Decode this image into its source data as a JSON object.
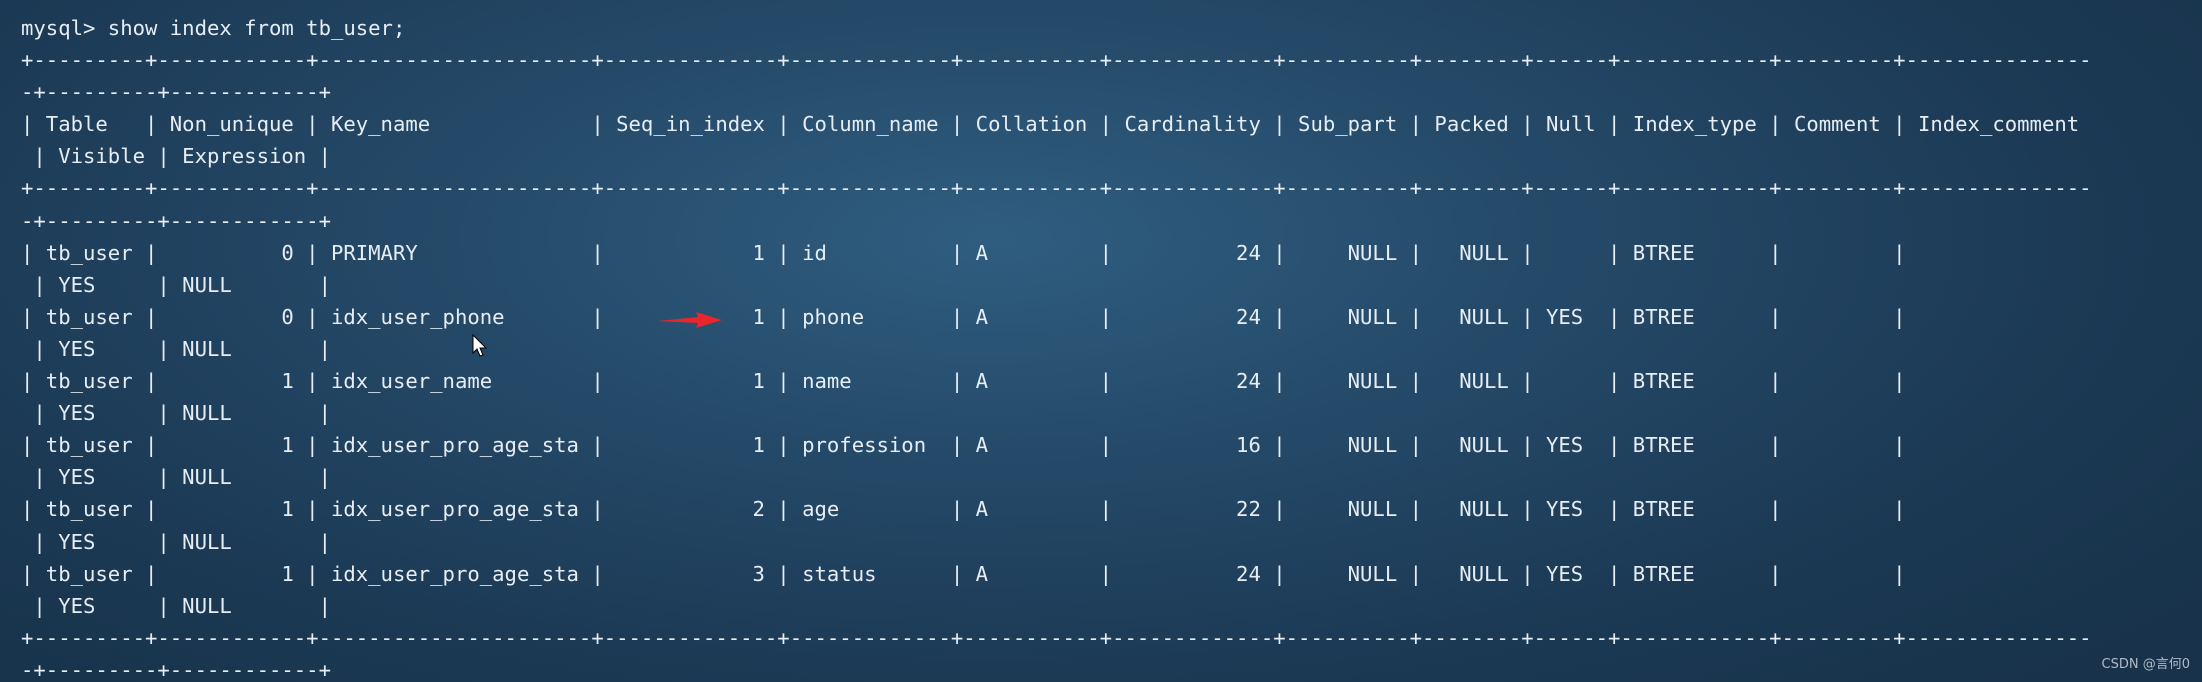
{
  "terminal": {
    "lines": [
      "mysql> show index from tb_user;",
      "+---------+------------+----------------------+--------------+-------------+-----------+-------------+----------+--------+------+------------+---------+---------------",
      "-+---------+------------+",
      "| Table   | Non_unique | Key_name             | Seq_in_index | Column_name | Collation | Cardinality | Sub_part | Packed | Null | Index_type | Comment | Index_comment",
      " | Visible | Expression |",
      "+---------+------------+----------------------+--------------+-------------+-----------+-------------+----------+--------+------+------------+---------+---------------",
      "-+---------+------------+",
      "| tb_user |          0 | PRIMARY              |            1 | id          | A         |          24 |     NULL |   NULL |      | BTREE      |         |",
      " | YES     | NULL       |",
      "| tb_user |          0 | idx_user_phone       |            1 | phone       | A         |          24 |     NULL |   NULL | YES  | BTREE      |         |",
      " | YES     | NULL       |",
      "| tb_user |          1 | idx_user_name        |            1 | name        | A         |          24 |     NULL |   NULL |      | BTREE      |         |",
      " | YES     | NULL       |",
      "| tb_user |          1 | idx_user_pro_age_sta |            1 | profession  | A         |          16 |     NULL |   NULL | YES  | BTREE      |         |",
      " | YES     | NULL       |",
      "| tb_user |          1 | idx_user_pro_age_sta |            2 | age         | A         |          22 |     NULL |   NULL | YES  | BTREE      |         |",
      " | YES     | NULL       |",
      "| tb_user |          1 | idx_user_pro_age_sta |            3 | status      | A         |          24 |     NULL |   NULL | YES  | BTREE      |         |",
      " | YES     | NULL       |",
      "+---------+------------+----------------------+--------------+-------------+-----------+-------------+----------+--------+------+------------+---------+---------------",
      "-+---------+------------+"
    ]
  },
  "watermark": "CSDN @言何0",
  "colors": {
    "text": "#e6edf3",
    "arrow": "#e8262b"
  },
  "annotations": {
    "arrow_icon": "red-arrow-icon",
    "cursor_icon": "mouse-pointer-icon"
  }
}
